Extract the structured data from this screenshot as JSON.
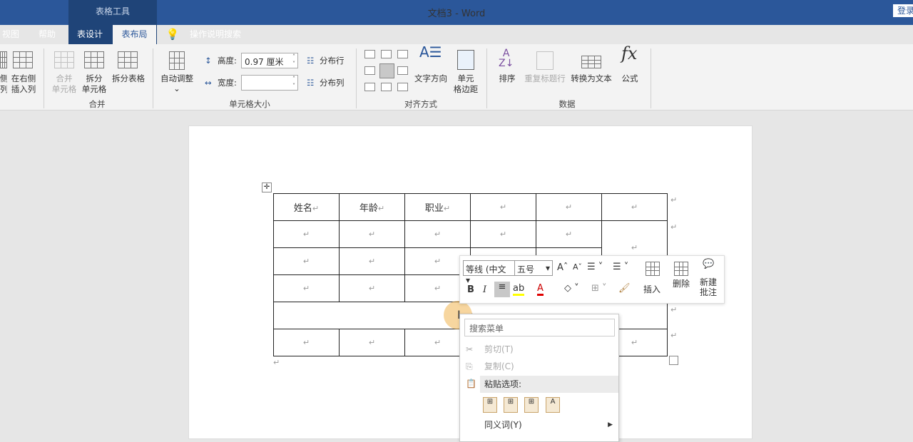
{
  "title_bar": {
    "context_tools": "表格工具",
    "document_title": "文档3  -  Word",
    "login": "登录"
  },
  "tabs": [
    "视图",
    "帮助",
    "表设计",
    "表布局"
  ],
  "active_tab": "表布局",
  "tell_me": "操作说明搜索",
  "ribbon": {
    "rows_cols": {
      "insert_left_partial": "侧\n列",
      "insert_right": "在右侧\n插入列"
    },
    "merge": {
      "merge_cells": "合并\n单元格",
      "split_cells": "拆分\n单元格",
      "split_table": "拆分表格",
      "group": "合并"
    },
    "cell_size": {
      "autofit": "自动调整",
      "height_label": "高度:",
      "height_value": "0.97 厘米",
      "width_label": "宽度:",
      "width_value": "",
      "distribute_rows": "分布行",
      "distribute_cols": "分布列",
      "group": "单元格大小"
    },
    "alignment": {
      "text_direction": "文字方向",
      "cell_margins": "单元\n格边距",
      "group": "对齐方式"
    },
    "data": {
      "sort": "排序",
      "repeat_header": "重复标题行",
      "convert_to_text": "转换为文本",
      "formula": "公式",
      "group": "数据"
    }
  },
  "table": {
    "headers": [
      "姓名",
      "年龄",
      "职业"
    ],
    "mark": "↵"
  },
  "mini_toolbar": {
    "font": "等线 (中文",
    "size": "五号",
    "bold": "B",
    "italic": "I",
    "insert": "插入",
    "delete": "删除",
    "new_comment": "新建\n批注"
  },
  "context_menu": {
    "search_placeholder": "搜索菜单",
    "cut": "剪切(T)",
    "copy": "复制(C)",
    "paste_options": "粘贴选项:",
    "synonyms": "同义词(Y)"
  },
  "colors": {
    "brand": "#2b579a",
    "highlight": "#ffff00",
    "font_color": "#e00000"
  }
}
